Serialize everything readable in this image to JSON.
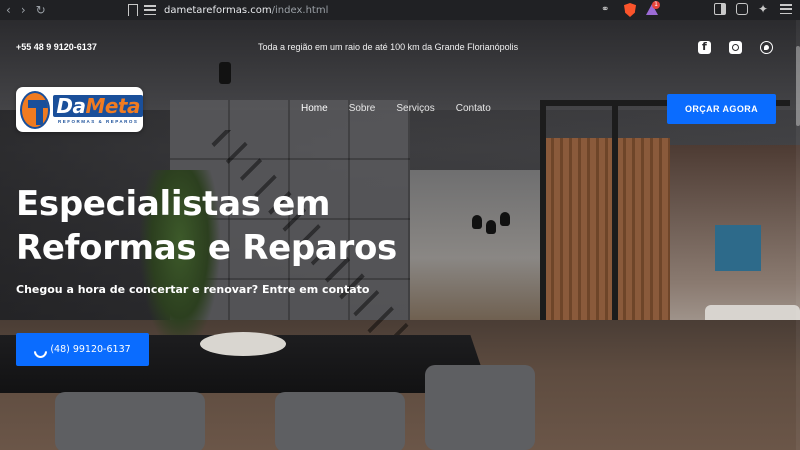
{
  "browser": {
    "url_host": "dametareformas.com",
    "url_path": "/index.html",
    "notification_count": "1"
  },
  "topbar": {
    "phone": "+55 48 9 9120-6137",
    "region": "Toda a região em um raio de até 100 km da Grande Florianópolis",
    "social_icons": [
      "facebook-icon",
      "instagram-icon",
      "whatsapp-icon"
    ]
  },
  "header": {
    "logo_word_a": "Da",
    "logo_word_b": "Meta",
    "logo_sub": "REFORMAS & REPAROS",
    "nav": [
      "Home",
      "Sobre",
      "Serviços",
      "Contato"
    ],
    "cta": "ORÇAR AGORA"
  },
  "hero": {
    "title_line1": "Especialistas em",
    "title_line2": "Reformas e Reparos",
    "subtitle": "Chegou a hora de concertar e renovar? Entre em contato",
    "phone_button": "(48) 99120-6137"
  },
  "colors": {
    "accent": "#0a6cff",
    "logo_blue": "#1a4f9a",
    "logo_orange": "#f07b21"
  }
}
